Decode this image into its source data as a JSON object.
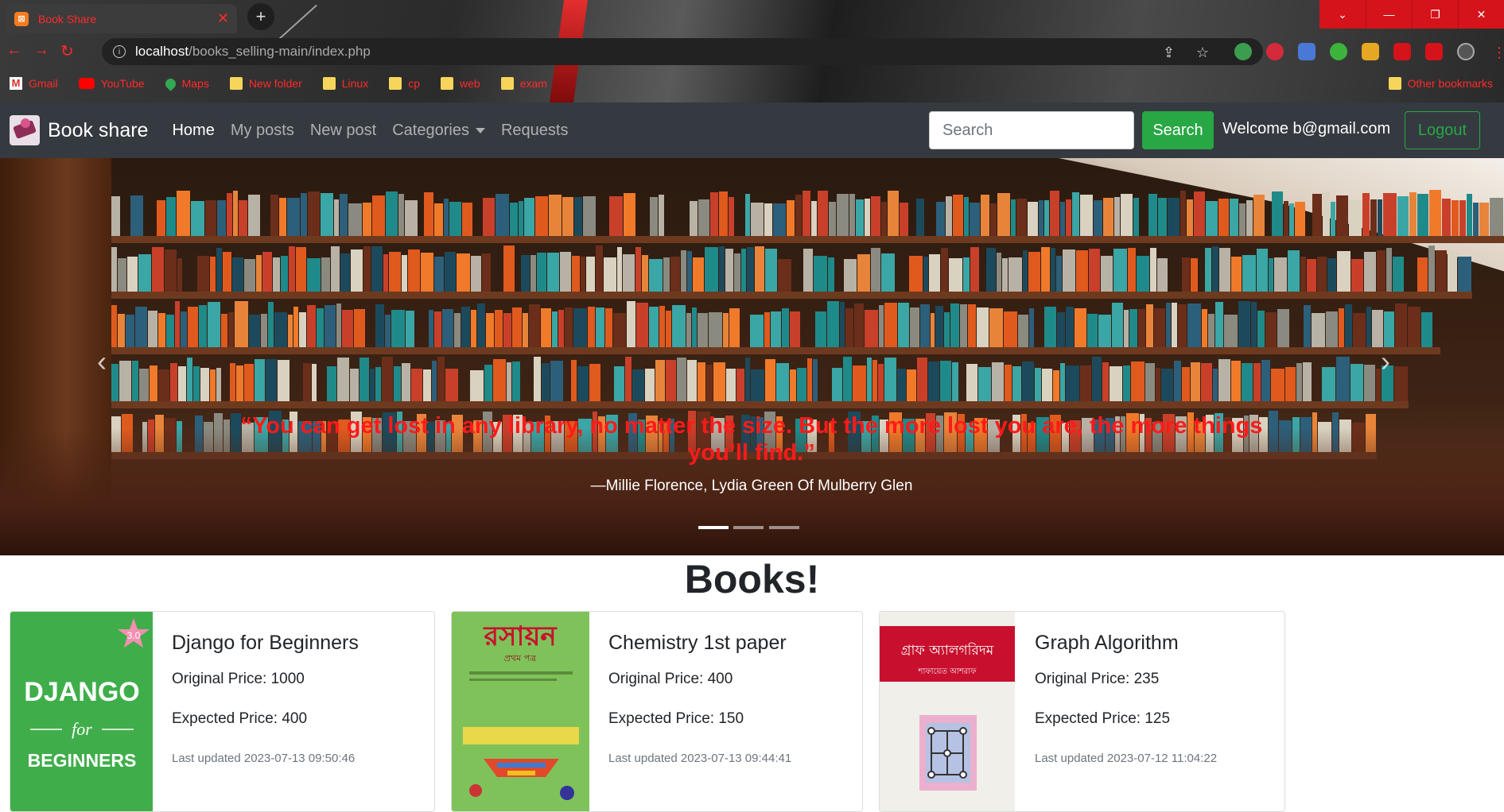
{
  "browser": {
    "tab_title": "Book Share",
    "tab_favicon": "xampp-icon",
    "url_host": "localhost",
    "url_path": "/books_selling-main/index.php",
    "bookmarks": [
      {
        "label": "Gmail",
        "icon": "gmail-icon"
      },
      {
        "label": "YouTube",
        "icon": "youtube-icon"
      },
      {
        "label": "Maps",
        "icon": "maps-icon"
      },
      {
        "label": "New folder",
        "icon": "folder-icon"
      },
      {
        "label": "Linux",
        "icon": "folder-icon"
      },
      {
        "label": "cp",
        "icon": "folder-icon"
      },
      {
        "label": "web",
        "icon": "folder-icon"
      },
      {
        "label": "exam",
        "icon": "folder-icon"
      }
    ],
    "other_bookmarks": "Other bookmarks"
  },
  "navbar": {
    "brand": "Book share",
    "links": [
      "Home",
      "My posts",
      "New post",
      "Categories",
      "Requests"
    ],
    "search_placeholder": "Search",
    "search_button": "Search",
    "welcome": "Welcome b@gmail.com",
    "logout": "Logout"
  },
  "carousel": {
    "quote": "“You can get lost in any library, no matter the size. But the more lost you are, the more things you’ll find.”",
    "author": "—Millie Florence, Lydia Green Of Mulberry Glen",
    "slides": 3,
    "active_slide": 1
  },
  "books_section": {
    "heading": "Books!",
    "books": [
      {
        "title": "Django for Beginners",
        "original_price": "Original Price: 1000",
        "expected_price": "Expected Price: 400",
        "updated": "Last updated 2023-07-13 09:50:46",
        "cover": {
          "line1": "DJANGO",
          "line2": "for",
          "line3": "BEGINNERS",
          "badge": "3.0",
          "color": "#3fae4a"
        }
      },
      {
        "title": "Chemistry 1st paper",
        "original_price": "Original Price: 400",
        "expected_price": "Expected Price: 150",
        "updated": "Last updated 2023-07-13 09:44:41",
        "cover": {
          "line1": "রসায়ন",
          "line2": "প্রথম পত্র",
          "color": "#7fc25a"
        }
      },
      {
        "title": "Graph Algorithm",
        "original_price": "Original Price: 235",
        "expected_price": "Expected Price: 125",
        "updated": "Last updated 2023-07-12 11:04:22",
        "cover": {
          "line1": "গ্রাফ অ্যালগরিদম",
          "line2": "শাফায়েত আশরাফ",
          "color": "#c8102e"
        }
      }
    ]
  },
  "colors": {
    "navbar_bg": "#343a40",
    "success": "#28a745",
    "quote_red": "#ff1a1a",
    "chrome_accent": "#d4131a"
  }
}
